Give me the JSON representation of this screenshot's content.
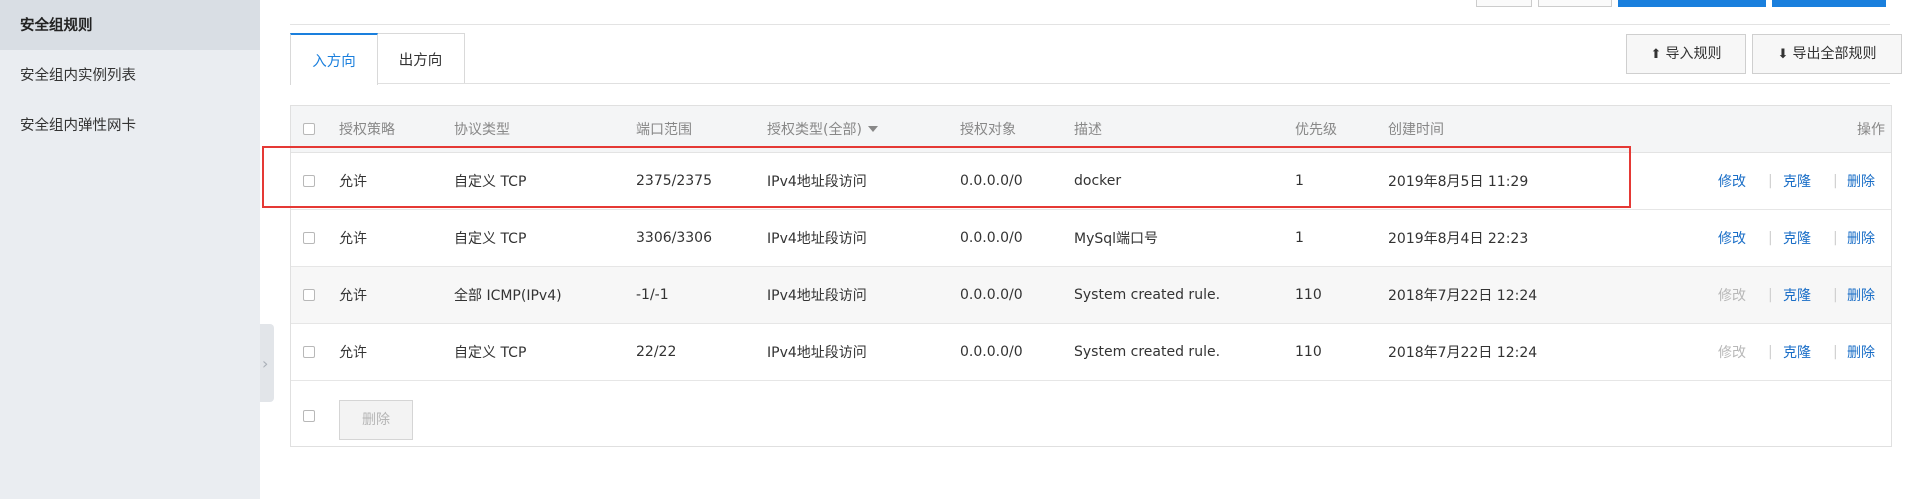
{
  "sidebar": {
    "items": [
      {
        "label": "安全组规则",
        "active": true
      },
      {
        "label": "安全组内实例列表",
        "active": false
      },
      {
        "label": "安全组内弹性网卡",
        "active": false
      }
    ]
  },
  "tabs": [
    {
      "label": "入方向",
      "active": true
    },
    {
      "label": "出方向",
      "active": false
    }
  ],
  "actions": {
    "import_label": "导入规则",
    "export_label": "导出全部规则"
  },
  "table": {
    "headers": {
      "policy": "授权策略",
      "protocol": "协议类型",
      "port": "端口范围",
      "auth_type": "授权类型(全部)",
      "auth_object": "授权对象",
      "description": "描述",
      "priority": "优先级",
      "created": "创建时间",
      "actions": "操作"
    },
    "rows": [
      {
        "policy": "允许",
        "protocol": "自定义 TCP",
        "port": "2375/2375",
        "auth_type": "IPv4地址段访问",
        "auth_object": "0.0.0.0/0",
        "description": "docker",
        "priority": "1",
        "created": "2019年8月5日 11:29",
        "edit": "修改",
        "clone": "克隆",
        "delete": "删除",
        "edit_enabled": true
      },
      {
        "policy": "允许",
        "protocol": "自定义 TCP",
        "port": "3306/3306",
        "auth_type": "IPv4地址段访问",
        "auth_object": "0.0.0.0/0",
        "description": "MySql端口号",
        "priority": "1",
        "created": "2019年8月4日 22:23",
        "edit": "修改",
        "clone": "克隆",
        "delete": "删除",
        "edit_enabled": true
      },
      {
        "policy": "允许",
        "protocol": "全部 ICMP(IPv4)",
        "port": "-1/-1",
        "auth_type": "IPv4地址段访问",
        "auth_object": "0.0.0.0/0",
        "description": "System created rule.",
        "priority": "110",
        "created": "2018年7月22日 12:24",
        "edit": "修改",
        "clone": "克隆",
        "delete": "删除",
        "edit_enabled": false
      },
      {
        "policy": "允许",
        "protocol": "自定义 TCP",
        "port": "22/22",
        "auth_type": "IPv4地址段访问",
        "auth_object": "0.0.0.0/0",
        "description": "System created rule.",
        "priority": "110",
        "created": "2018年7月22日 12:24",
        "edit": "修改",
        "clone": "克隆",
        "delete": "删除",
        "edit_enabled": false
      }
    ],
    "separator": "|",
    "batch_delete_label": "删除"
  },
  "colors": {
    "accent": "#1a7fdd",
    "link": "#1a6ec7",
    "highlight": "#e53935"
  }
}
